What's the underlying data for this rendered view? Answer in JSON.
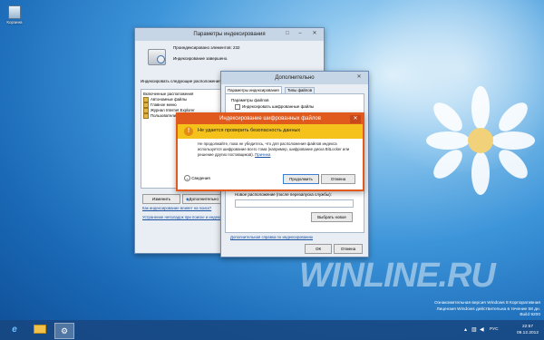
{
  "desktop": {
    "recycle_bin_label": "Корзина",
    "watermark": "WINLINE.RU",
    "evaluation": [
      "Ознакомительная версия Windows 8 Корпоративная",
      "Лицензия Windows действительна в течение 58 дн.",
      "Build 9200"
    ]
  },
  "indexing_window": {
    "title": "Параметры индексирования",
    "indexed_count": "Проиндексировано элементов: 232",
    "status": "Индексирование завершено.",
    "index_locations_label": "Индексировать следующие расположения:",
    "included_header": "Включенные расположения",
    "locations": [
      "Автономные файлы",
      "Главное меню",
      "Журнал Internet Explorer",
      "Пользователи"
    ],
    "modify_button": "Изменить",
    "advanced_button": "Дополнительно",
    "help_link": "Как индексирование влияет на поиск?",
    "troubleshoot_link": "Устранение неполадок при поиске и индексировании"
  },
  "advanced_window": {
    "title": "Дополнительно",
    "tabs": [
      "Параметры индексирования",
      "Типы файлов"
    ],
    "file_settings_label": "Параметры файлов",
    "encrypt_checkbox_label": "Индексировать шифрованные файлы",
    "current_location_value": "C:\\ProgramData\\Microsoft",
    "new_location_label": "Новое расположение (после перезапуска службы):",
    "select_new_button": "Выбрать новое",
    "help_link": "Дополнительная справка по индексированию",
    "ok_button": "ОК",
    "cancel_button": "Отмена"
  },
  "dialog": {
    "title": "Индексирование шифрованных файлов",
    "heading": "Не удается проверить безопасность данных",
    "body": "Не продолжайте, пока не убедитесь, что для расположения файлов индекса используется шифрование всего тома (например, шифрование диска BitLocker или решение других поставщиков).",
    "details_link": "Причина",
    "details_toggle": "Сведения",
    "continue_button": "Продолжить",
    "cancel_button": "Отмена"
  },
  "taskbar": {
    "language": "РУС",
    "time": "22:57",
    "date": "09.12.2012"
  },
  "colors": {
    "dialog_header": "#f4c21a",
    "dialog_border": "#e05a1e",
    "desktop": "#1a69b7",
    "taskbar": "#184680"
  }
}
